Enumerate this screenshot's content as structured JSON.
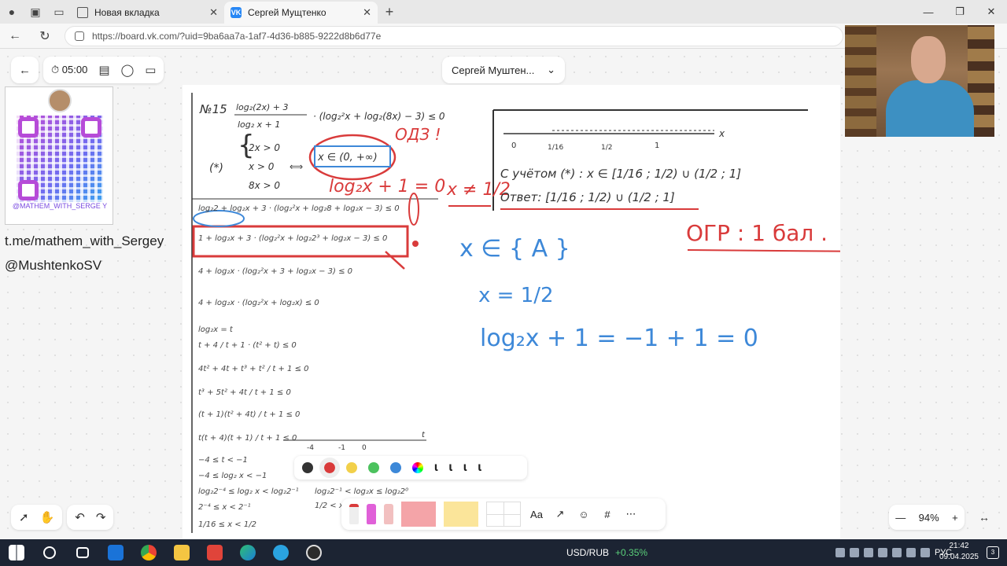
{
  "browser": {
    "tabs": [
      {
        "label": "Новая вкладка"
      },
      {
        "label": "Сергей Мущтенко"
      }
    ],
    "url": "https://board.vk.com/?uid=9ba6aa7a-1af7-4d36-b885-9222d8b6d77e"
  },
  "board": {
    "timer": "05:00",
    "user_name": "Сергей Муштен...",
    "qr_label": "@MATHEM_WITH_SERGE Y",
    "telegram_link": "t.me/mathem_with_Sergey",
    "handle": "@MushtenkoSV",
    "zoom": "94%",
    "text_tool": "Aa"
  },
  "handwriting": {
    "problem_number": "№15",
    "odz": "ОДЗ !",
    "odz_result": "x ∈ (0, +∞)",
    "cond_1": "2x > 0",
    "cond_2": "x > 0",
    "cond_3": "8x > 0",
    "star": "(*)",
    "log_eq": "log₂x + 1 = 0",
    "x_ne": "x ≠ 1/2",
    "given": "С учётом (*) : x ∈ [1/16 ; 1/2) ∪ (1/2 ; 1]",
    "answer": "Ответ: [1/16 ; 1/2) ∪ (1/2 ; 1]",
    "ogr": "ОГР : 1 бал .",
    "set_a": "x ∈ { A }",
    "x_value": "x = 1/2",
    "check": "log₂x + 1 = −1 + 1 = 0",
    "axis_x": "x",
    "axis_t": "t",
    "tick_0": "0",
    "tick_116": "1/16",
    "tick_12": "1/2",
    "tick_1": "1",
    "tick_m4": "-4",
    "tick_m1": "-1",
    "tick_t0": "0"
  },
  "taskbar": {
    "currency": "USD/RUB",
    "change": "+0.35%",
    "lang": "РУС",
    "time": "21:42",
    "date": "09.04.2025",
    "notifications": "3"
  },
  "colors": {
    "ink_red": "#d93b3b",
    "ink_blue": "#3d88d8",
    "ink_dark": "#333333"
  }
}
